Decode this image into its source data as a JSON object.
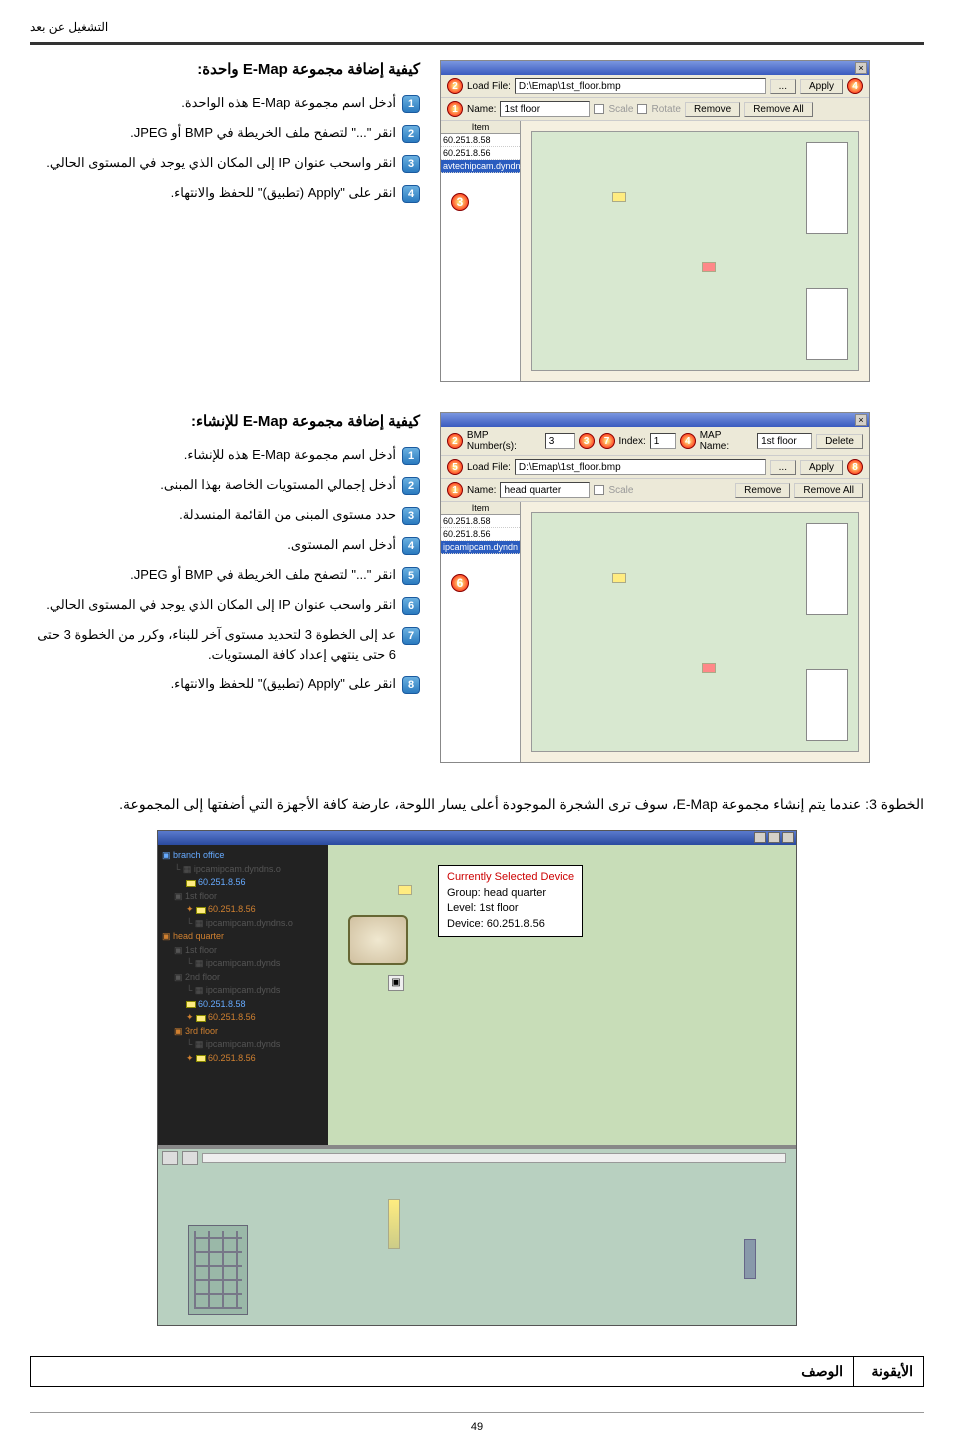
{
  "header": "التشغيل عن بعد",
  "section1": {
    "title": "كيفية إضافة مجموعة E-Map واحدة:",
    "steps": [
      "أدخل اسم مجموعة E-Map هذه الواحدة.",
      "انقر \"...\" لتصفح ملف الخريطة في BMP أو JPEG.",
      "انقر واسحب عنوان IP إلى المكان الذي يوجد في المستوى الحالي.",
      "انقر على \"Apply (تطبيق)\" للحفظ والانتهاء."
    ],
    "dialog": {
      "loadFileLabel": "Load File:",
      "loadFileValue": "D:\\Emap\\1st_floor.bmp",
      "browseBtn": "...",
      "applyBtn": "Apply",
      "nameLabel": "Name:",
      "nameValue": "1st floor",
      "scaleLabel": "Scale",
      "rotateLabel": "Rotate",
      "removeBtn": "Remove",
      "removeAllBtn": "Remove All",
      "itemHeader": "Item",
      "items": [
        "60.251.8.58",
        "60.251.8.56",
        "avtechipcam.dyndns"
      ]
    }
  },
  "section2": {
    "title": "كيفية إضافة مجموعة E-Map للإنشاء:",
    "steps": [
      "أدخل اسم مجموعة E-Map هذه للإنشاء.",
      "أدخل إجمالي المستويات الخاصة بهذا المبنى.",
      "حدد مستوى المبنى من القائمة المنسدلة.",
      "أدخل اسم المستوى.",
      "انقر \"...\" لتصفح ملف الخريطة في BMP أو JPEG.",
      "انقر واسحب عنوان IP إلى المكان الذي يوجد في المستوى الحالي.",
      "عد إلى الخطوة 3 لتحديد مستوى آخر للبناء، وكرر من الخطوة 3 حتى 6 حتى ينتهي إعداد كافة المستويات.",
      "انقر على \"Apply (تطبيق)\" للحفظ والانتهاء."
    ],
    "dialog": {
      "bmpNumLabel": "BMP Number(s):",
      "bmpNumValue": "3",
      "indexLabel": "Index:",
      "indexValue": "1",
      "mapNameLabel": "MAP Name:",
      "mapNameValue": "1st floor",
      "deleteBtn": "Delete",
      "loadFileLabel": "Load File:",
      "loadFileValue": "D:\\Emap\\1st_floor.bmp",
      "browseBtn": "...",
      "applyBtn": "Apply",
      "nameLabel": "Name:",
      "nameValue": "head quarter",
      "scaleLabel": "Scale",
      "removeBtn": "Remove",
      "removeAllBtn": "Remove All",
      "itemHeader": "Item",
      "items": [
        "60.251.8.58",
        "60.251.8.56",
        "ipcamipcam.dyndn"
      ]
    }
  },
  "caption": "الخطوة 3: عندما يتم إنشاء مجموعة E-Map، سوف ترى الشجرة الموجودة أعلى يسار اللوحة، عارضة كافة الأجهزة التي أضفتها إلى المجموعة.",
  "viewer": {
    "tree": {
      "root1": "branch office",
      "ip1": "ipcamipcam.dyndns.o",
      "ip1b": "60.251.8.56",
      "lvl1": "1st floor",
      "ip2": "60.251.8.56",
      "ip2b": "ipcamipcam.dyndns.o",
      "root2": "head quarter",
      "lvl2a": "1st floor",
      "ip3": "ipcamipcam.dynds",
      "lvl2b": "2nd floor",
      "ip4": "ipcamipcam.dynds",
      "ip4b": "60.251.8.58",
      "ip4c": "60.251.8.56",
      "lvl2c": "3rd floor",
      "ip5": "ipcamipcam.dynds",
      "ip5b": "60.251.8.56"
    },
    "info": {
      "line1": "Currently Selected Device",
      "line2a": "Group:",
      "line2b": "head quarter",
      "line3a": "Level:",
      "line3b": "1st floor",
      "line4a": "Device:",
      "line4b": "60.251.8.56"
    }
  },
  "table": {
    "colIcon": "الأيقونة",
    "colDesc": "الوصف"
  },
  "pageNum": "49"
}
